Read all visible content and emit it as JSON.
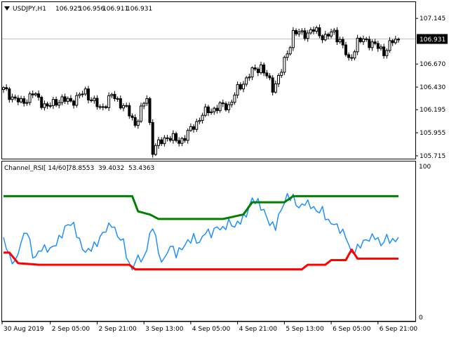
{
  "header": {
    "symbol": "USDJPY,H1",
    "open": "106.925",
    "high": "106.956",
    "low": "106.911",
    "close": "106.931"
  },
  "indicator": {
    "name": "Channel_RSI",
    "params": "[ 14/60]",
    "values": [
      "78.8553",
      "39.4032",
      "53.4363"
    ]
  },
  "price_labels": [
    "107.145",
    "106.670",
    "106.430",
    "106.195",
    "105.955",
    "105.715"
  ],
  "current_price": "106.931",
  "rsi_labels": [
    "100",
    "0"
  ],
  "time_labels": [
    "30 Aug 2019",
    "2 Sep 05:00",
    "2 Sep 21:00",
    "3 Sep 13:00",
    "4 Sep 05:00",
    "4 Sep 21:00",
    "5 Sep 13:00",
    "6 Sep 05:00",
    "6 Sep 21:00"
  ],
  "colors": {
    "candles": "#000000",
    "price_line": "#c0c0c0",
    "current_price_bg": "#000000",
    "current_price_fg": "#ffffff",
    "rsi_line": "#1e90ff",
    "upper_band": "#008000",
    "lower_band": "#ff0000"
  },
  "chart_data": [
    {
      "type": "candlestick",
      "title": "USDJPY,H1",
      "ylim": [
        105.7,
        107.3
      ],
      "anchors": [
        [
          0,
          106.4
        ],
        [
          6,
          106.26
        ],
        [
          10,
          106.36
        ],
        [
          15,
          106.22
        ],
        [
          19,
          106.3
        ],
        [
          23,
          106.28
        ],
        [
          28,
          106.38
        ],
        [
          33,
          106.2
        ],
        [
          37,
          106.34
        ],
        [
          41,
          106.24
        ],
        [
          45,
          106.05
        ],
        [
          49,
          106.32
        ],
        [
          51,
          105.78
        ],
        [
          56,
          105.92
        ],
        [
          60,
          105.86
        ],
        [
          64,
          105.98
        ],
        [
          68,
          106.15
        ],
        [
          73,
          106.22
        ],
        [
          77,
          106.24
        ],
        [
          80,
          106.4
        ],
        [
          84,
          106.56
        ],
        [
          88,
          106.65
        ],
        [
          92,
          106.42
        ],
        [
          95,
          106.6
        ],
        [
          97,
          106.78
        ],
        [
          99,
          107.0
        ],
        [
          102,
          106.98
        ],
        [
          106,
          107.02
        ],
        [
          110,
          106.95
        ],
        [
          113,
          107.0
        ],
        [
          115,
          106.92
        ],
        [
          118,
          106.7
        ],
        [
          121,
          106.9
        ],
        [
          124,
          106.92
        ],
        [
          127,
          106.86
        ],
        [
          130,
          106.8
        ],
        [
          133,
          106.9
        ],
        [
          135,
          106.93
        ]
      ]
    },
    {
      "type": "line",
      "title": "Channel_RSI[ 14/60]",
      "ylim": [
        0,
        100
      ],
      "series": [
        {
          "color": "#1e90ff",
          "anchors": [
            [
              0,
              53
            ],
            [
              2,
              40
            ],
            [
              4,
              36
            ],
            [
              6,
              50
            ],
            [
              8,
              58
            ],
            [
              10,
              41
            ],
            [
              11,
              40
            ],
            [
              13,
              46
            ],
            [
              16,
              45
            ],
            [
              18,
              49
            ],
            [
              20,
              55
            ],
            [
              22,
              62
            ],
            [
              24,
              61
            ],
            [
              26,
              50
            ],
            [
              28,
              43
            ],
            [
              30,
              46
            ],
            [
              32,
              49
            ],
            [
              34,
              56
            ],
            [
              36,
              60
            ],
            [
              37,
              62
            ],
            [
              39,
              54
            ],
            [
              41,
              50
            ],
            [
              43,
              34
            ],
            [
              44,
              33
            ],
            [
              46,
              40
            ],
            [
              48,
              38
            ],
            [
              50,
              55
            ],
            [
              51,
              58
            ],
            [
              52,
              56
            ],
            [
              53,
              40
            ],
            [
              55,
              38
            ],
            [
              57,
              48
            ],
            [
              59,
              42
            ],
            [
              61,
              46
            ],
            [
              63,
              50
            ],
            [
              65,
              53
            ],
            [
              67,
              49
            ],
            [
              69,
              57
            ],
            [
              71,
              55
            ],
            [
              73,
              60
            ],
            [
              75,
              58
            ],
            [
              77,
              63
            ],
            [
              79,
              60
            ],
            [
              81,
              64
            ],
            [
              83,
              68
            ],
            [
              85,
              78
            ],
            [
              87,
              76
            ],
            [
              89,
              70
            ],
            [
              91,
              62
            ],
            [
              93,
              60
            ],
            [
              95,
              72
            ],
            [
              97,
              80
            ],
            [
              99,
              79
            ],
            [
              101,
              72
            ],
            [
              103,
              76
            ],
            [
              105,
              74
            ],
            [
              107,
              70
            ],
            [
              109,
              71
            ],
            [
              111,
              63
            ],
            [
              113,
              62
            ],
            [
              115,
              58
            ],
            [
              117,
              54
            ],
            [
              119,
              42
            ],
            [
              121,
              46
            ],
            [
              123,
              50
            ],
            [
              125,
              52
            ],
            [
              127,
              54
            ],
            [
              129,
              48
            ],
            [
              131,
              53
            ],
            [
              133,
              50
            ],
            [
              135,
              53
            ]
          ]
        },
        {
          "color": "#008000",
          "anchors": [
            [
              0,
              80
            ],
            [
              44,
              80
            ],
            [
              46,
              70
            ],
            [
              50,
              68
            ],
            [
              53,
              65
            ],
            [
              75,
              65
            ],
            [
              82,
              68
            ],
            [
              85,
              76
            ],
            [
              96,
              76
            ],
            [
              99,
              80
            ],
            [
              135,
              80
            ]
          ]
        },
        {
          "color": "#ff0000",
          "anchors": [
            [
              0,
              43
            ],
            [
              2,
              43
            ],
            [
              5,
              36
            ],
            [
              12,
              35
            ],
            [
              43,
              35
            ],
            [
              45,
              32
            ],
            [
              102,
              32
            ],
            [
              104,
              35
            ],
            [
              110,
              35
            ],
            [
              112,
              38
            ],
            [
              117,
              38
            ],
            [
              119,
              45
            ],
            [
              121,
              39
            ],
            [
              135,
              39
            ]
          ]
        }
      ]
    }
  ]
}
